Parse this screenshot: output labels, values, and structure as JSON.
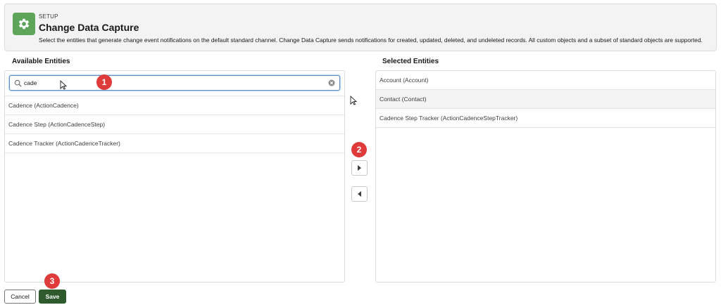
{
  "header": {
    "eyebrow": "SETUP",
    "title": "Change Data Capture",
    "description": "Select the entities that generate change event notifications on the default standard channel. Change Data Capture sends notifications for created, updated, deleted, and undeleted records. All custom objects and a subset of standard objects are supported.",
    "icon": "gear-icon"
  },
  "available": {
    "label": "Available Entities",
    "search_value": "cade",
    "items": [
      "Cadence (ActionCadence)",
      "Cadence Step (ActionCadenceStep)",
      "Cadence Tracker (ActionCadenceTracker)"
    ]
  },
  "selected": {
    "label": "Selected Entities",
    "items": [
      "Account (Account)",
      "Contact (Contact)",
      "Cadence Step Tracker (ActionCadenceStepTracker)"
    ],
    "highlighted_index": 1
  },
  "badges": [
    "1",
    "2",
    "3"
  ],
  "buttons": {
    "cancel": "Cancel",
    "save": "Save"
  },
  "colors": {
    "header_icon": "#5ea55a",
    "badge": "#e03b3b",
    "save_button": "#2e5a2e",
    "focus_border": "#5a8fc4"
  }
}
